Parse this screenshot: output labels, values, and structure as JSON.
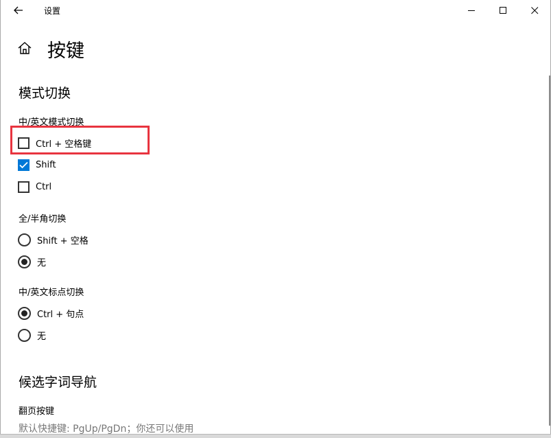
{
  "window": {
    "title": "设置"
  },
  "page": {
    "title": "按键"
  },
  "sections": {
    "mode_switch": {
      "title": "模式切换",
      "cn_en_mode": {
        "label": "中/英文模式切换",
        "options": [
          {
            "label": "Ctrl + 空格键",
            "checked": false
          },
          {
            "label": "Shift",
            "checked": true
          },
          {
            "label": "Ctrl",
            "checked": false
          }
        ]
      },
      "full_half": {
        "label": "全/半角切换",
        "options": [
          {
            "label": "Shift + 空格",
            "selected": false
          },
          {
            "label": "无",
            "selected": true
          }
        ]
      },
      "punctuation": {
        "label": "中/英文标点切换",
        "options": [
          {
            "label": "Ctrl + 句点",
            "selected": true
          },
          {
            "label": "无",
            "selected": false
          }
        ]
      }
    },
    "candidate_nav": {
      "title": "候选字词导航",
      "paging": {
        "label": "翻页按键",
        "hint": "默认快捷键: PgUp/PgDn；你还可以使用"
      }
    }
  },
  "colors": {
    "accent": "#0078d7",
    "highlight": "#e8343f"
  },
  "icons": {
    "back": "back-arrow-icon",
    "home": "home-icon",
    "minimize": "minimize-icon",
    "maximize": "maximize-icon",
    "close": "close-icon"
  }
}
